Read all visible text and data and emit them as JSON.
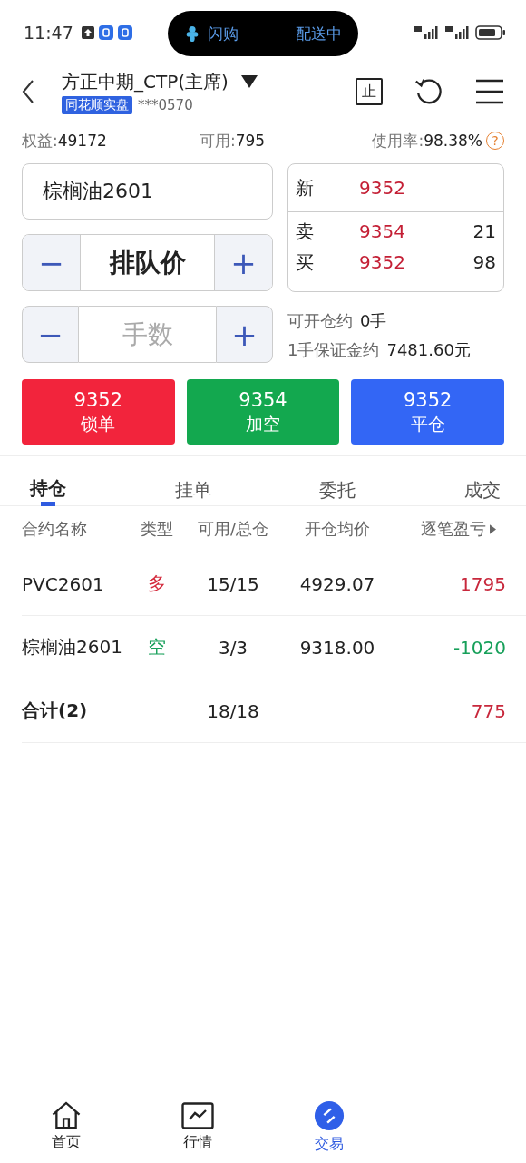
{
  "status_bar": {
    "time": "11:47",
    "island_left": "闪购",
    "island_right": "配送中"
  },
  "header": {
    "title": "方正中期_CTP(主席)",
    "badge": "同花顺实盘",
    "account": "***0570",
    "stop_icon": "止"
  },
  "summary": [
    {
      "label": "权益:",
      "value": "49172"
    },
    {
      "label": "可用:",
      "value": "795"
    },
    {
      "label": "使用率:",
      "value": "98.38%",
      "help": "?"
    }
  ],
  "contract": {
    "value": "棕榈油2601"
  },
  "price_stepper": {
    "minus": "−",
    "value": "排队价",
    "plus": "+"
  },
  "qty_stepper": {
    "minus": "−",
    "placeholder": "手数",
    "plus": "+"
  },
  "quote": {
    "last": {
      "label": "新",
      "price": "9352"
    },
    "book": [
      {
        "label": "卖",
        "price": "9354",
        "volume": "21"
      },
      {
        "label": "买",
        "price": "9352",
        "volume": "98"
      }
    ]
  },
  "info": [
    {
      "label": "可开仓约",
      "value": "0手"
    },
    {
      "label": "1手保证金约",
      "value": "7481.60元"
    }
  ],
  "actions": [
    {
      "price": "9352",
      "label": "锁单",
      "color": "#f2243c"
    },
    {
      "price": "9354",
      "label": "加空",
      "color": "#13a84f"
    },
    {
      "price": "9352",
      "label": "平仓",
      "color": "#3366f5"
    }
  ],
  "tabs": [
    {
      "label": "持仓",
      "selected": true
    },
    {
      "label": "挂单",
      "selected": false
    },
    {
      "label": "委托",
      "selected": false
    },
    {
      "label": "成交",
      "selected": false
    }
  ],
  "table": {
    "columns": [
      "合约名称",
      "类型",
      "可用/总仓",
      "开仓均价",
      "逐笔盈亏"
    ],
    "rows": [
      {
        "name": "PVC2601",
        "type": {
          "text": "多",
          "color": "#d42a3c"
        },
        "avail": "15/15",
        "avg": "4929.07",
        "pnl": {
          "text": "1795",
          "color": "#c8283c"
        }
      },
      {
        "name": "棕榈油2601",
        "type": {
          "text": "空",
          "color": "#17a05a"
        },
        "avail": "3/3",
        "avg": "9318.00",
        "pnl": {
          "text": "-1020",
          "color": "#17a05a"
        }
      }
    ],
    "total": {
      "label": "合计(2)",
      "avail": "18/18",
      "pnl": {
        "text": "775",
        "color": "#c8283c"
      }
    }
  },
  "nav": [
    {
      "label": "首页",
      "kind": "home",
      "selected": false
    },
    {
      "label": "行情",
      "kind": "chart",
      "selected": false
    },
    {
      "label": "交易",
      "kind": "trade",
      "selected": true
    }
  ]
}
